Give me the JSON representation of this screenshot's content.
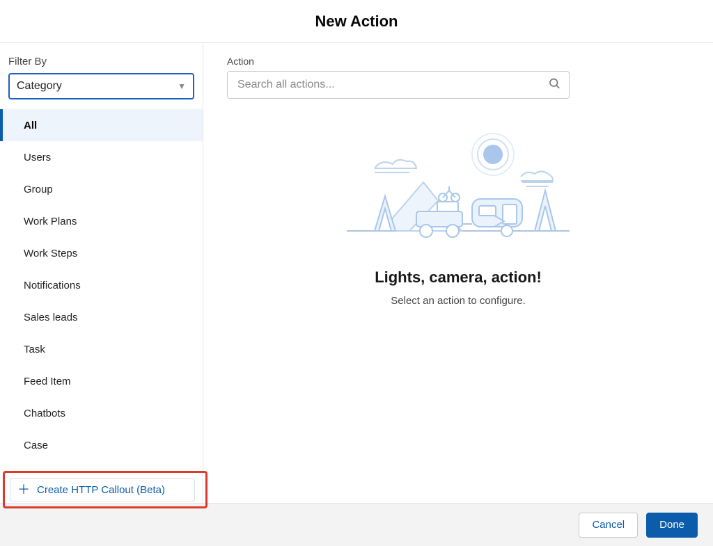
{
  "title": "New Action",
  "sidebar": {
    "filter_label": "Filter By",
    "filter_value": "Category",
    "categories": [
      "All",
      "Users",
      "Group",
      "Work Plans",
      "Work Steps",
      "Notifications",
      "Sales leads",
      "Task",
      "Feed Item",
      "Chatbots",
      "Case"
    ],
    "selected_index": 0,
    "http_callout_label": "Create HTTP Callout (Beta)"
  },
  "main": {
    "action_label": "Action",
    "search_placeholder": "Search all actions...",
    "empty_heading": "Lights, camera, action!",
    "empty_sub": "Select an action to configure."
  },
  "footer": {
    "cancel": "Cancel",
    "done": "Done"
  }
}
